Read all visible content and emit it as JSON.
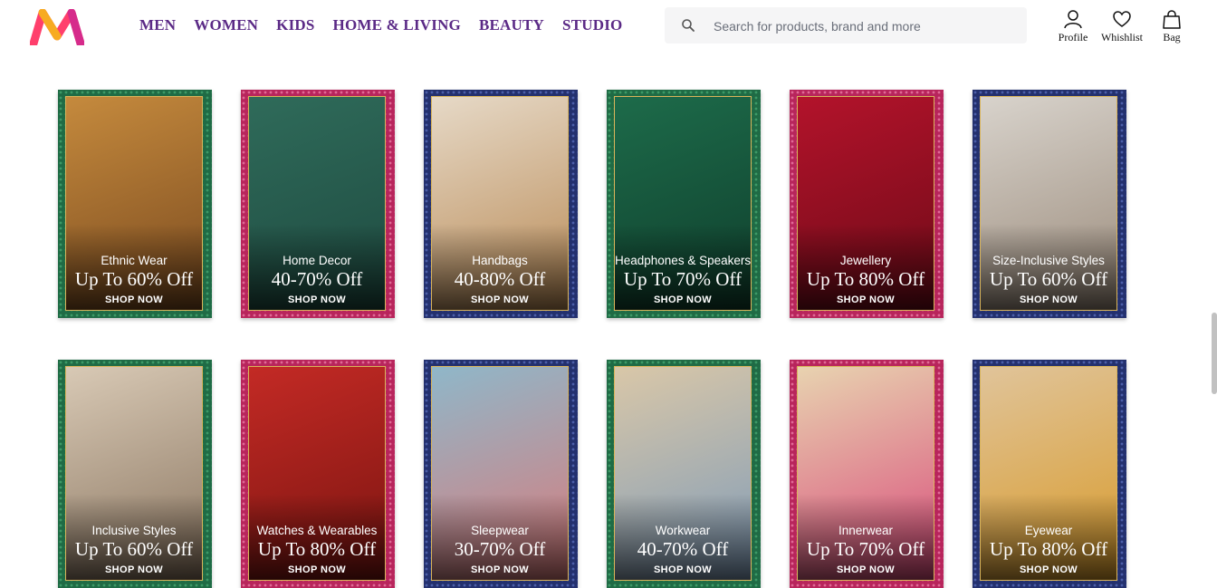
{
  "header": {
    "logo": {
      "icon": "myntra-logo-icon",
      "colors": [
        "#ff3f6c",
        "#f7ab21",
        "#d62b8b"
      ]
    },
    "nav": [
      "MEN",
      "WOMEN",
      "KIDS",
      "HOME & LIVING",
      "BEAUTY",
      "STUDIO"
    ],
    "search": {
      "placeholder": "Search for products, brand and more",
      "value": "",
      "icon": "search-icon"
    },
    "actions": [
      {
        "label": "Profile",
        "icon": "user-icon"
      },
      {
        "label": "Whishlist",
        "icon": "heart-icon"
      },
      {
        "label": "Bag",
        "icon": "bag-icon"
      }
    ]
  },
  "colors": {
    "nav": "#5b2a86",
    "accent": "#ff3f6c",
    "green_border": "#1f6b45",
    "pink_border": "#b8255c",
    "blue_border": "#23306e",
    "frame_gold": "#d9b45a"
  },
  "cards": [
    {
      "title": "Ethnic Wear",
      "offer": "Up To 60% Off",
      "cta": "SHOP NOW",
      "border": "green",
      "image": "couple in ethnic wear"
    },
    {
      "title": "Home Decor",
      "offer": "40-70% Off",
      "cta": "SHOP NOW",
      "border": "pink",
      "image": "blue velvet armchair"
    },
    {
      "title": "Handbags",
      "offer": "40-80% Off",
      "cta": "SHOP NOW",
      "border": "blue",
      "image": "tan leather handbag"
    },
    {
      "title": "Headphones & Speakers",
      "offer": "Up To 70% Off",
      "cta": "SHOP NOW",
      "border": "green",
      "image": "red headphones and speaker"
    },
    {
      "title": "Jewellery",
      "offer": "Up To 80% Off",
      "cta": "SHOP NOW",
      "border": "pink",
      "image": "coral jewellery set"
    },
    {
      "title": "Size-Inclusive Styles",
      "offer": "Up To 60% Off",
      "cta": "SHOP NOW",
      "border": "blue",
      "image": "woman in polo tee"
    },
    {
      "title": "Inclusive Styles",
      "offer": "Up To 60% Off",
      "cta": "SHOP NOW",
      "border": "green",
      "image": "man in printed shirt"
    },
    {
      "title": "Watches & Wearables",
      "offer": "Up To 80% Off",
      "cta": "SHOP NOW",
      "border": "pink",
      "image": "wrist watches"
    },
    {
      "title": "Sleepwear",
      "offer": "30-70% Off",
      "cta": "SHOP NOW",
      "border": "blue",
      "image": "couple in sleepwear"
    },
    {
      "title": "Workwear",
      "offer": "40-70% Off",
      "cta": "SHOP NOW",
      "border": "green",
      "image": "couple in workwear"
    },
    {
      "title": "Innerwear",
      "offer": "Up To 70% Off",
      "cta": "SHOP NOW",
      "border": "pink",
      "image": "pink lingerie"
    },
    {
      "title": "Eyewear",
      "offer": "Up To 80% Off",
      "cta": "SHOP NOW",
      "border": "blue",
      "image": "yellow aviator sunglasses"
    }
  ]
}
